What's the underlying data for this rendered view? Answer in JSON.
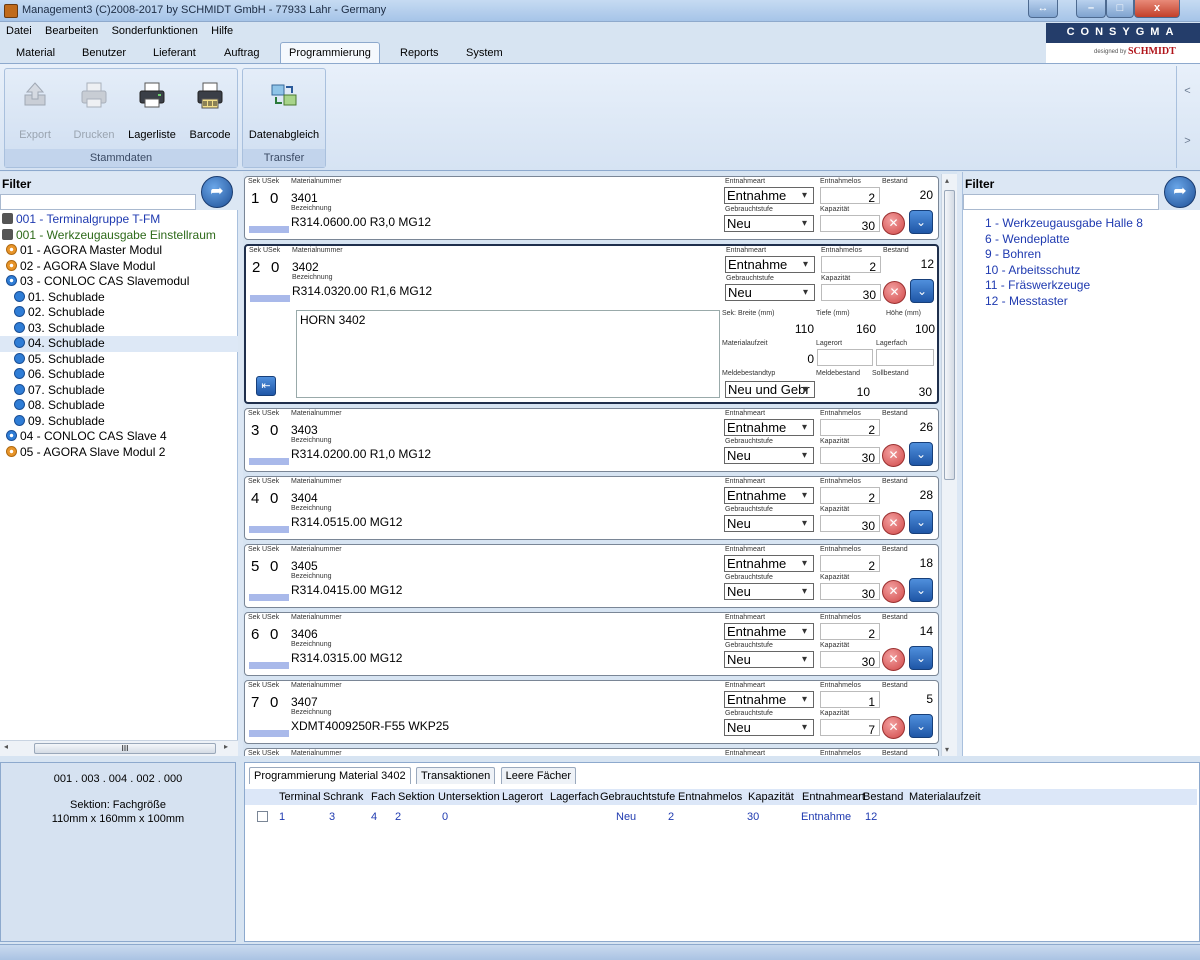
{
  "window": {
    "title": "Management3 (C)2008-2017 by SCHMIDT GmbH - 77933 Lahr - Germany"
  },
  "menu": [
    "Datei",
    "Bearbeiten",
    "Sonderfunktionen",
    "Hilfe"
  ],
  "brand": {
    "name": "CONSYGMA",
    "designed_by": "designed by",
    "company": "SCHMIDT"
  },
  "ribbon_tabs": [
    "Material",
    "Benutzer",
    "Lieferant",
    "Auftrag",
    "Programmierung",
    "Reports",
    "System"
  ],
  "active_tab": "Programmierung",
  "ribbon": {
    "groups": [
      {
        "label": "Stammdaten",
        "buttons": [
          {
            "label": "Export",
            "icon": "export-icon",
            "enabled": false
          },
          {
            "label": "Drucken",
            "icon": "printer-icon",
            "enabled": false
          },
          {
            "label": "Lagerliste",
            "icon": "printer-icon",
            "enabled": true
          },
          {
            "label": "Barcode",
            "icon": "barcode-printer-icon",
            "enabled": true
          }
        ]
      },
      {
        "label": "Transfer",
        "buttons": [
          {
            "label": "Datenabgleich",
            "icon": "sync-icon",
            "enabled": true
          }
        ]
      }
    ],
    "scroll_left": "<",
    "scroll_right": ">"
  },
  "left_panel": {
    "filter_label": "Filter",
    "filter_value": "",
    "tree": [
      {
        "label": "001 - Terminalgruppe T-FM",
        "icon": "group-icon",
        "color": "#1f3ab0",
        "indent": 0
      },
      {
        "label": "001 - Werkzeugausgabe Einstellraum",
        "icon": "terminal-icon",
        "color": "#2e6a1a",
        "indent": 0
      },
      {
        "label": "01 - AGORA Master Modul",
        "icon": "orange",
        "color": "#000000",
        "indent": 1
      },
      {
        "label": "02 - AGORA Slave Modul",
        "icon": "orange",
        "color": "#000000",
        "indent": 1
      },
      {
        "label": "03 - CONLOC CAS Slavemodul",
        "icon": "blue",
        "color": "#000000",
        "indent": 1
      },
      {
        "label": "01. Schublade",
        "icon": "drawer",
        "color": "#000000",
        "indent": 2
      },
      {
        "label": "02. Schublade",
        "icon": "drawer",
        "color": "#000000",
        "indent": 2
      },
      {
        "label": "03. Schublade",
        "icon": "drawer",
        "color": "#000000",
        "indent": 2
      },
      {
        "label": "04. Schublade",
        "icon": "drawer",
        "color": "#000000",
        "indent": 2,
        "selected": true
      },
      {
        "label": "05. Schublade",
        "icon": "drawer",
        "color": "#000000",
        "indent": 2
      },
      {
        "label": "06. Schublade",
        "icon": "drawer",
        "color": "#000000",
        "indent": 2
      },
      {
        "label": "07. Schublade",
        "icon": "drawer",
        "color": "#000000",
        "indent": 2
      },
      {
        "label": "08. Schublade",
        "icon": "drawer",
        "color": "#000000",
        "indent": 2
      },
      {
        "label": "09. Schublade",
        "icon": "drawer",
        "color": "#000000",
        "indent": 2
      },
      {
        "label": "04 - CONLOC CAS Slave 4",
        "icon": "blue",
        "color": "#000000",
        "indent": 1
      },
      {
        "label": "05 - AGORA Slave Modul 2",
        "icon": "orange",
        "color": "#000000",
        "indent": 1
      }
    ],
    "hscroll_grip": "III"
  },
  "card_labels": {
    "sek": "Sek",
    "usek": "USek",
    "materialnummer": "Materialnummer",
    "bezeichnung": "Bezeichnung",
    "entnahmeart": "Entnahmeart",
    "entnahmelos": "Entnahmelos",
    "bestand": "Bestand",
    "gebrauchtstufe": "Gebrauchtstufe",
    "kapazitaet": "Kapazität",
    "breite": "Sek: Breite (mm)",
    "tiefe": "Tiefe (mm)",
    "hoehe": "Höhe (mm)",
    "materialaufzeit": "Materialaufzeit",
    "lagerort": "Lagerort",
    "lagerfach": "Lagerfach",
    "meldebestandtyp": "Meldebestandtyp",
    "meldebestand": "Meldebestand",
    "sollbestand": "Sollbestand"
  },
  "cards": [
    {
      "sek": "1",
      "usek": "0",
      "materialnummer": "3401",
      "bezeichnung": "R314.0600.00 R3,0  MG12",
      "entnahmeart": "Entnahme",
      "entnahmelos": "2",
      "bestand": "20",
      "gebrauchtstufe": "Neu",
      "kapazitaet": "30"
    },
    {
      "sek": "2",
      "usek": "0",
      "materialnummer": "3402",
      "bezeichnung": "R314.0320.00 R1,6  MG12",
      "entnahmeart": "Entnahme",
      "entnahmelos": "2",
      "bestand": "12",
      "gebrauchtstufe": "Neu",
      "kapazitaet": "30",
      "expanded": true,
      "detail": {
        "note": "HORN 3402",
        "breite": "110",
        "tiefe": "160",
        "hoehe": "100",
        "materialaufzeit": "0",
        "lagerort": "",
        "lagerfach": "",
        "meldebestandtyp": "Neu und Gebr",
        "meldebestand": "10",
        "sollbestand": "30"
      }
    },
    {
      "sek": "3",
      "usek": "0",
      "materialnummer": "3403",
      "bezeichnung": "R314.0200.00 R1,0  MG12",
      "entnahmeart": "Entnahme",
      "entnahmelos": "2",
      "bestand": "26",
      "gebrauchtstufe": "Neu",
      "kapazitaet": "30"
    },
    {
      "sek": "4",
      "usek": "0",
      "materialnummer": "3404",
      "bezeichnung": "R314.0515.00  MG12",
      "entnahmeart": "Entnahme",
      "entnahmelos": "2",
      "bestand": "28",
      "gebrauchtstufe": "Neu",
      "kapazitaet": "30"
    },
    {
      "sek": "5",
      "usek": "0",
      "materialnummer": "3405",
      "bezeichnung": "R314.0415.00  MG12",
      "entnahmeart": "Entnahme",
      "entnahmelos": "2",
      "bestand": "18",
      "gebrauchtstufe": "Neu",
      "kapazitaet": "30"
    },
    {
      "sek": "6",
      "usek": "0",
      "materialnummer": "3406",
      "bezeichnung": "R314.0315.00  MG12",
      "entnahmeart": "Entnahme",
      "entnahmelos": "2",
      "bestand": "14",
      "gebrauchtstufe": "Neu",
      "kapazitaet": "30"
    },
    {
      "sek": "7",
      "usek": "0",
      "materialnummer": "3407",
      "bezeichnung": "XDMT4009250R-F55  WKP25",
      "entnahmeart": "Entnahme",
      "entnahmelos": "1",
      "bestand": "5",
      "gebrauchtstufe": "Neu",
      "kapazitaet": "7"
    },
    {
      "partial": true
    }
  ],
  "right_panel": {
    "filter_label": "Filter",
    "filter_value": "",
    "categories": [
      "1 - Werkzeugausgabe Halle 8",
      "6 - Wendeplatte",
      "9 - Bohren",
      "10 - Arbeitsschutz",
      "11 - Fräswerkzeuge",
      "12 - Messtaster"
    ]
  },
  "bottom_left": {
    "path": "001 . 003 . 004 . 002 . 000",
    "section": "Sektion: Fachgröße",
    "dimensions": "110mm x 160mm x 100mm"
  },
  "bottom_tabs": [
    "Programmierung Material 3402",
    "Transaktionen",
    "Leere Fächer"
  ],
  "grid": {
    "columns": [
      "Terminal",
      "Schrank",
      "Fach",
      "Sektion",
      "Untersektion",
      "Lagerort",
      "Lagerfach",
      "Gebrauchtstufe",
      "Entnahmelos",
      "Kapazität",
      "Entnahmeart",
      "Bestand",
      "Materialaufzeit"
    ],
    "rows": [
      {
        "Terminal": "1",
        "Schrank": "3",
        "Fach": "4",
        "Sektion": "2",
        "Untersektion": "0",
        "Lagerort": "",
        "Lagerfach": "",
        "Gebrauchtstufe": "Neu",
        "Entnahmelos": "2",
        "Kapazität": "30",
        "Entnahmeart": "Entnahme",
        "Bestand": "12",
        "Materialaufzeit": ""
      }
    ]
  },
  "colors": {
    "accent": "#1f3ab0",
    "ribbon_bg": "#d6e3f3",
    "selection": "#dde8f6"
  }
}
